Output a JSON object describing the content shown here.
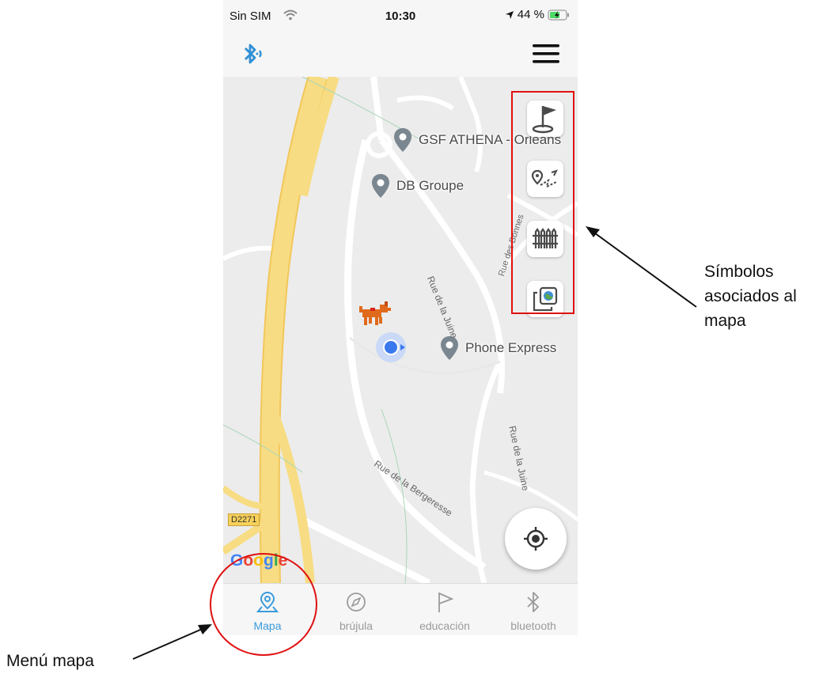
{
  "status_bar": {
    "carrier": "Sin SIM",
    "time": "10:30",
    "battery": "44 %"
  },
  "map": {
    "pois": [
      "GSF ATHENA - Orleans",
      "DB Groupe",
      "Phone Express"
    ],
    "street_labels": [
      "Rue de la Juine",
      "Rue des Bonnes",
      "Rue de la Bergeresse",
      "Rue de la Juine"
    ],
    "road_sign": "D2271",
    "attribution": "Google"
  },
  "tabs": [
    {
      "label": "Mapa",
      "icon": "map-pin-icon"
    },
    {
      "label": "brújula",
      "icon": "compass-icon"
    },
    {
      "label": "educación",
      "icon": "flag-icon"
    },
    {
      "label": "bluetooth",
      "icon": "bluetooth-icon"
    }
  ],
  "side_buttons": [
    "flag-pole-icon",
    "route-icon",
    "fence-icon",
    "map-layers-icon"
  ],
  "annotations": {
    "symbols": [
      "Símbolos",
      "asociados al",
      "mapa"
    ],
    "menu": "Menú mapa"
  },
  "colors": {
    "accent": "#3a9bdc",
    "annotation": "#e01010",
    "highway": "#f7dc83"
  }
}
